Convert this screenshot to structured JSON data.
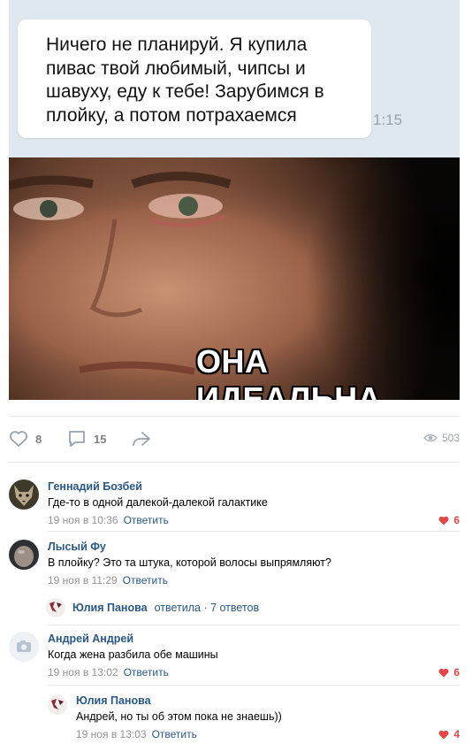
{
  "chat": {
    "message_lines": [
      "Ничего не планируй. Я купила",
      "пивас твой любимый, чипсы и",
      "шавуху, еду к тебе! Зарубимся в",
      "плойку, а потом потрахаемся"
    ],
    "time": "1:15"
  },
  "meme": {
    "caption": "ОНА ИДЕАЛЬНА"
  },
  "actions": {
    "likes": "8",
    "comments": "15",
    "views": "503"
  },
  "comments": [
    {
      "author": "Геннадий Бозбей",
      "text": "Где-то в одной далекой-далекой галактике",
      "date": "19 ноя в 10:36",
      "reply_label": "Ответить",
      "likes": "6"
    },
    {
      "author": "Лысый Фу",
      "text": "В плойку? Это та штука, которой волосы выпрямляют?",
      "date": "19 ноя в 11:29",
      "reply_label": "Ответить",
      "likes": ""
    },
    {
      "author": "Андрей Андрей",
      "text": "Когда жена разбила обе машины",
      "date": "19 ноя в 13:02",
      "reply_label": "Ответить",
      "likes": "6"
    }
  ],
  "thread_summary": {
    "author": "Юлия Панова",
    "text": "ответила · 7 ответов"
  },
  "reply": {
    "author": "Юлия Панова",
    "text": "Андрей, но ты об этом пока не знаешь))",
    "date": "19 ноя в 13:03",
    "reply_label": "Ответить",
    "likes": "4"
  },
  "colors": {
    "link": "#2a5885",
    "like_red": "#e64646",
    "chat_bg": "#dfe7ef"
  }
}
